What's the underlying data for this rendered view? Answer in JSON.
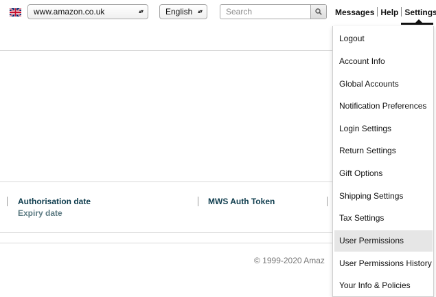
{
  "topbar": {
    "marketplace": "www.amazon.co.uk",
    "language": "English",
    "search_placeholder": "Search",
    "links": [
      "Messages",
      "Help",
      "Settings"
    ]
  },
  "table": {
    "columns": {
      "authorisation_date": "Authorisation date",
      "expiry_date": "Expiry date",
      "mws_auth_token": "MWS Auth Token"
    }
  },
  "footer": {
    "copyright": "© 1999-2020 Amaz"
  },
  "settings_menu": {
    "items": [
      "Logout",
      "Account Info",
      "Global Accounts",
      "Notification Preferences",
      "Login Settings",
      "Return Settings",
      "Gift Options",
      "Shipping Settings",
      "Tax Settings",
      "User Permissions",
      "User Permissions History",
      "Your Info & Policies"
    ],
    "highlighted": "User Permissions"
  },
  "icons": {
    "flag": "uk-flag-icon",
    "search": "search-icon",
    "select_arrows": "select-arrows-icon"
  },
  "colors": {
    "header_text": "#0f3d4e",
    "subheader_text": "#5c7a82",
    "highlight": "#e6e6e6"
  }
}
